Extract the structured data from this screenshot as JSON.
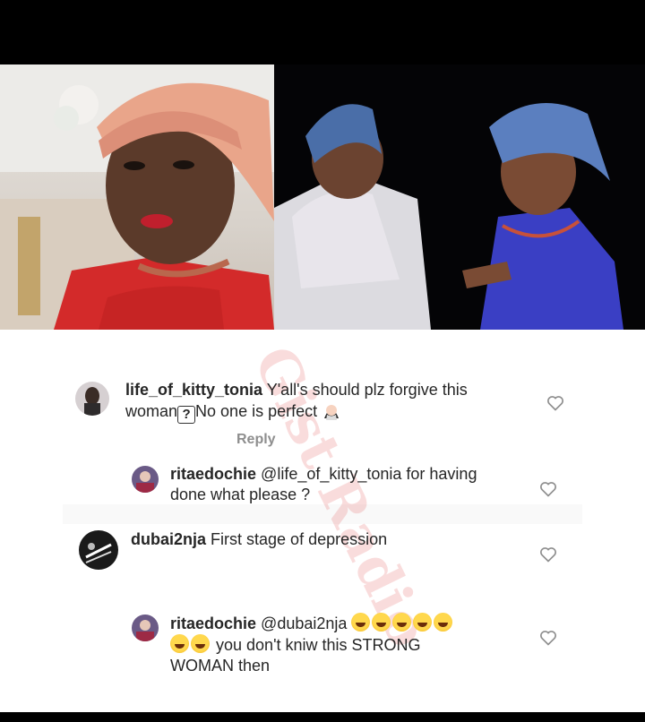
{
  "photos": {
    "left_alt": "woman in red gele looking sideways",
    "right_alt": "two women in blue gele dancing on stage"
  },
  "watermark": {
    "text": "Gist Radio"
  },
  "comments": [
    {
      "username": "life_of_kitty_tonia",
      "text_line1": "Y'all's should plz forgive this",
      "text_line2_pre": "woman",
      "text_line2_box": "?",
      "text_line2_post": "No one is perfect",
      "emoji_icon": "woman-facepalming-icon",
      "reply_label": "Reply"
    },
    {
      "username": "ritaedochie",
      "text_line1": "@life_of_kitty_tonia for having",
      "text_line2": "done what please ?"
    },
    {
      "username": "dubai2nja",
      "text": "First stage of depression"
    },
    {
      "username": "ritaedochie",
      "text_line1": "@dubai2nja",
      "text_line2": "you don't kniw this STRONG",
      "text_line3": "WOMAN then",
      "emoji_icon": "face-with-tears-of-joy-icon"
    }
  ],
  "colors": {
    "text": "#262626",
    "muted": "#8e8e8e",
    "heart_outline": "#8e8e8e"
  }
}
